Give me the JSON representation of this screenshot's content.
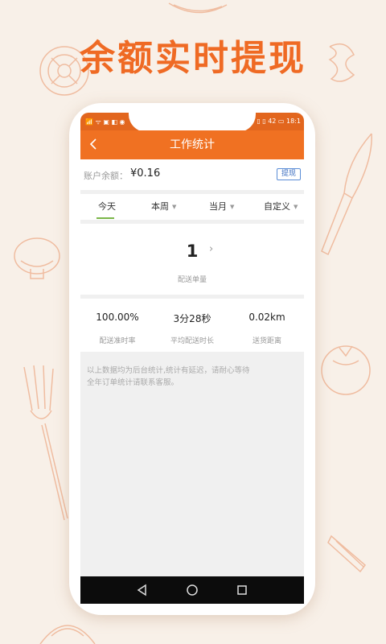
{
  "promo": {
    "headline": "余额实时提现"
  },
  "status_bar": {
    "left_icons": "📶 ᯤ ▣ ◧ ◉",
    "right_text": "▯ ▯ 42 ▭ 18:1"
  },
  "header": {
    "back_icon": "chevron-left-icon",
    "title": "工作统计"
  },
  "balance": {
    "label": "账户余额：",
    "value": "¥0.16",
    "withdraw_label": "提现"
  },
  "tabs": [
    {
      "label": "今天",
      "active": true,
      "has_caret": false
    },
    {
      "label": "本周",
      "active": false,
      "has_caret": true
    },
    {
      "label": "当月",
      "active": false,
      "has_caret": true
    },
    {
      "label": "自定义",
      "active": false,
      "has_caret": true
    }
  ],
  "orders": {
    "count": "1",
    "label": "配送单量"
  },
  "stats": [
    {
      "value": "100.00%",
      "label": "配送准时率"
    },
    {
      "value": "3分28秒",
      "label": "平均配送时长"
    },
    {
      "value": "0.02km",
      "label": "送货距离"
    }
  ],
  "notice": {
    "line1": "以上数据均为后台统计,统计有延迟，请耐心等待",
    "line2": "全年订单统计请联系客服。"
  },
  "nav": {
    "back": "back-triangle-icon",
    "home": "home-circle-icon",
    "recents": "recents-square-icon"
  },
  "colors": {
    "accent": "#f07122",
    "headline": "#ef6a24",
    "background": "#f8f0e8",
    "tab_underline": "#7ab648",
    "withdraw_border": "#5b8dd6"
  }
}
